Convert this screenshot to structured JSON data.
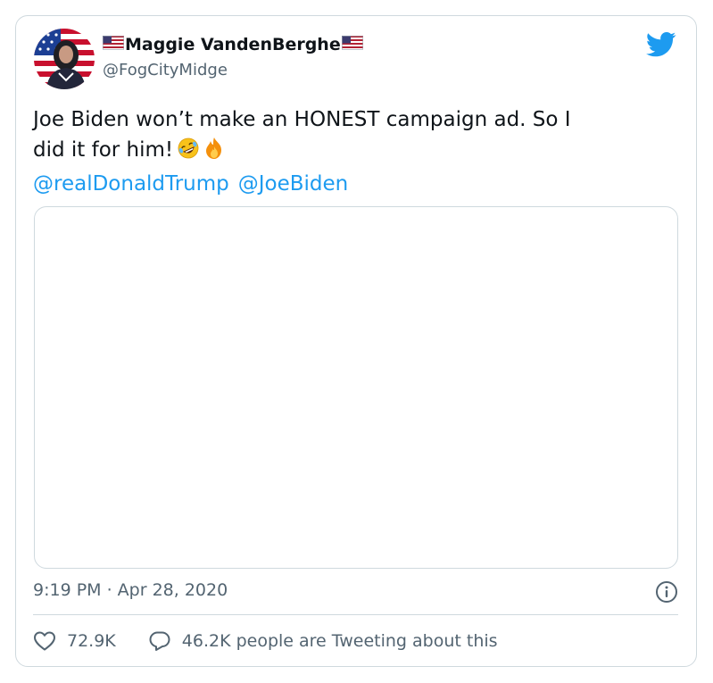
{
  "tweet": {
    "author": {
      "display_name": "Maggie VandenBerghe",
      "handle": "@FogCityMidge",
      "name_emoji": "us-flag"
    },
    "text_line1": "Joe Biden won’t make an HONEST campaign ad. So I",
    "text_line2": "did it for him!",
    "emojis": [
      "rolling-on-floor-laughing",
      "fire"
    ],
    "mentions": [
      "@realDonaldTrump",
      "@JoeBiden"
    ],
    "timestamp": "9:19 PM · Apr 28, 2020",
    "likes": "72.9K",
    "conversation": "46.2K people are Tweeting about this"
  },
  "colors": {
    "accent": "#1d9bf0",
    "text": "#0f1419",
    "secondary": "#536471",
    "border": "#cfd9de"
  },
  "icons": [
    "twitter-bird-icon",
    "info-icon",
    "heart-icon",
    "reply-bubble-icon"
  ]
}
